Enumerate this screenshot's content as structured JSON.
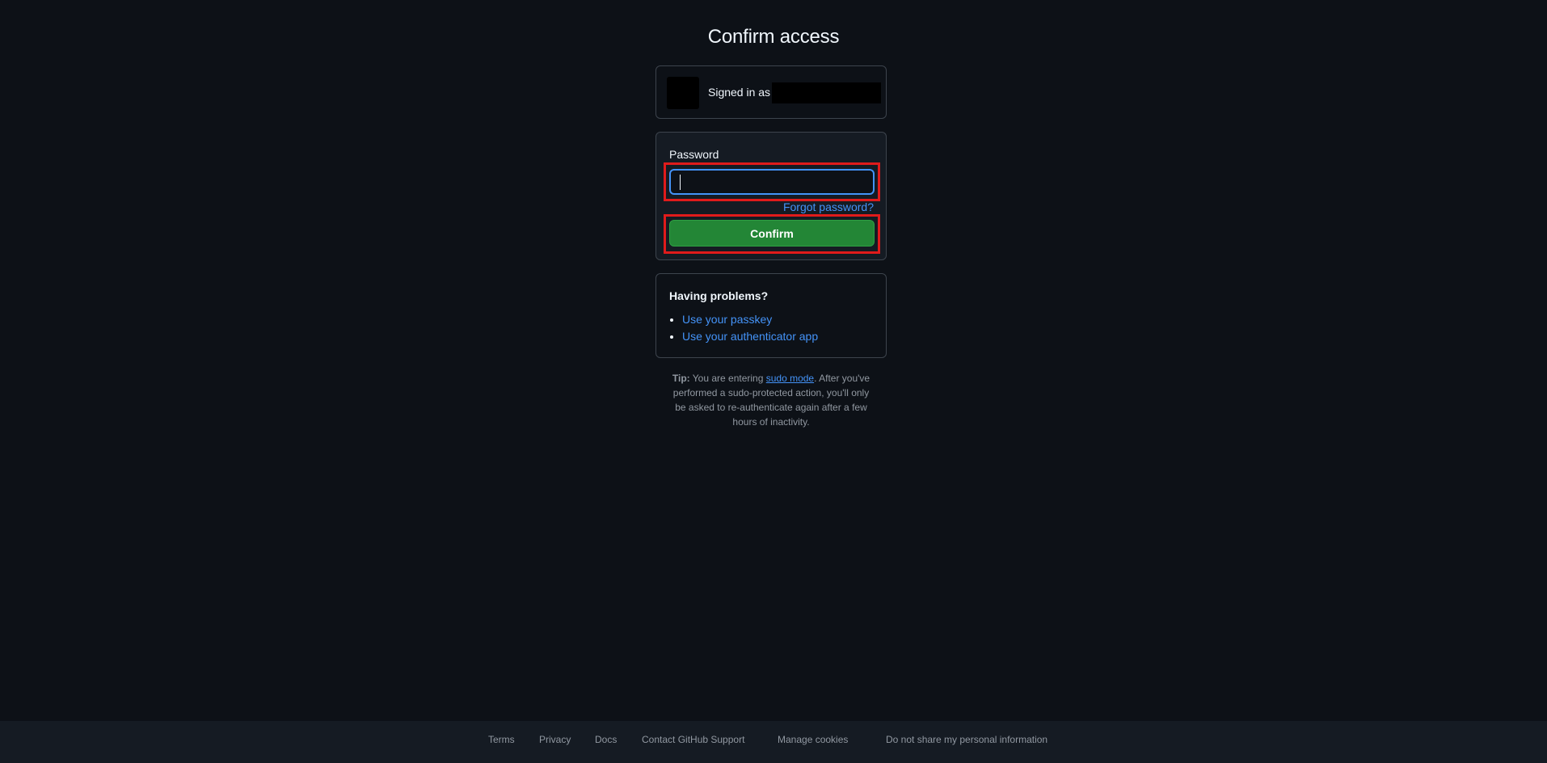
{
  "page": {
    "title": "Confirm access"
  },
  "signed_in": {
    "text": "Signed in as"
  },
  "form": {
    "password_label": "Password",
    "password_value": "",
    "forgot_link": "Forgot password?",
    "confirm_label": "Confirm"
  },
  "problems": {
    "heading": "Having problems?",
    "items": [
      {
        "label": "Use your passkey"
      },
      {
        "label": "Use your authenticator app"
      }
    ]
  },
  "tip": {
    "prefix": "Tip:",
    "before_link": " You are entering ",
    "link": "sudo mode",
    "after_link": ". After you've performed a sudo-protected action, you'll only be asked to re-authenticate again after a few hours of inactivity."
  },
  "footer": {
    "links": [
      "Terms",
      "Privacy",
      "Docs",
      "Contact GitHub Support",
      "Manage cookies",
      "Do not share my personal information"
    ]
  },
  "colors": {
    "background": "#0d1117",
    "accent_link": "#4493f8",
    "primary_button": "#238636",
    "highlight": "#e01b1b"
  }
}
